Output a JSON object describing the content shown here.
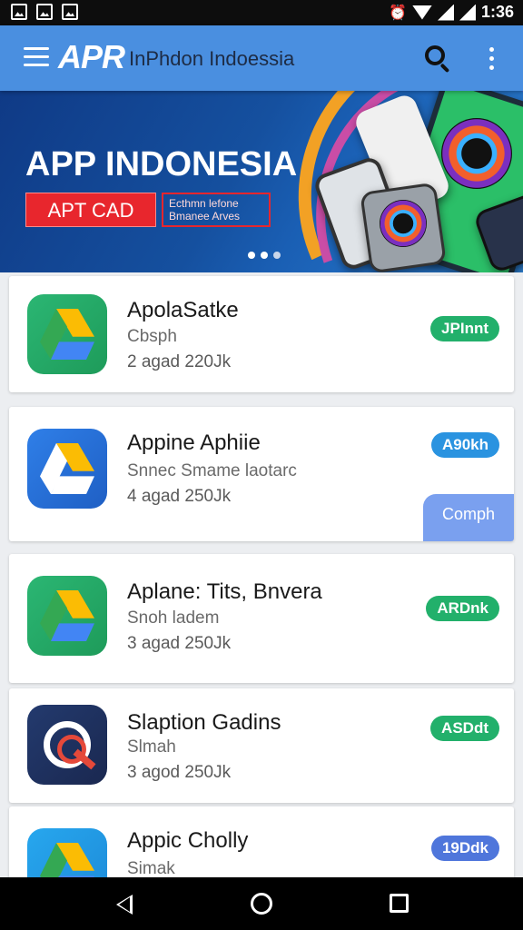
{
  "status_bar": {
    "time": "1:36"
  },
  "app_bar": {
    "brand": "APR",
    "title": "InPhdon Indoessia"
  },
  "banner": {
    "title": "APP INDONESIA",
    "cta_label": "APT CAD",
    "sub_label": "Ecthmn lefone Bmanee Arves",
    "dots": 3,
    "active_dot": 1
  },
  "apps": [
    {
      "name": "ApolaSatke",
      "category": "Cbsph",
      "meta": "2 agad 220Jk",
      "button": "JPInnt"
    },
    {
      "name": "Appine Aphiie",
      "category": "Snnec Smame laotarc",
      "meta": "4 agad 250Jk",
      "button": "A90kh",
      "chip": "Comph"
    },
    {
      "name": "Aplane: Tits, Bnvera",
      "category": "Snoh ladem",
      "meta": "3 agad 250Jk",
      "button": "ARDnk"
    },
    {
      "name": "Slaption Gadins",
      "category": "Slmah",
      "meta": "3 agod 250Jk",
      "button": "ASDdt"
    },
    {
      "name": "Appic Cholly",
      "category": "Simak",
      "meta": "",
      "button": "19Ddk"
    }
  ],
  "colors": {
    "app_bar": "#4a8fe0",
    "cta": "#e8262d",
    "pill_green": "#22b06b",
    "pill_blue": "#2a93e0"
  }
}
